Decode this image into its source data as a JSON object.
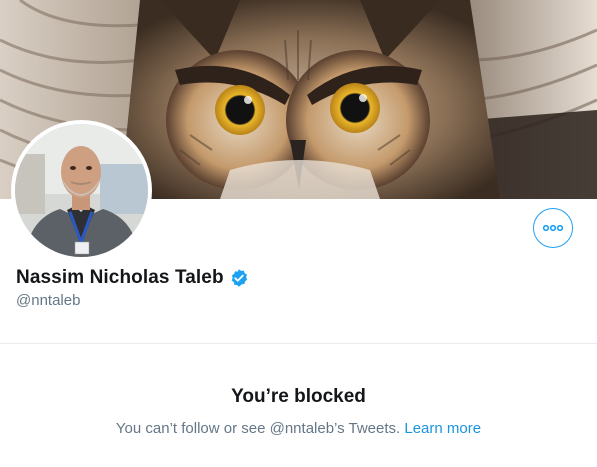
{
  "profile": {
    "display_name": "Nassim Nicholas Taleb",
    "handle": "@nntaleb"
  },
  "icons": {
    "verified": "verified-badge-icon",
    "more": "more-horizontal-icon"
  },
  "blocked": {
    "title": "You’re blocked",
    "message_prefix": "You can’t follow or see @nntaleb’s Tweets.",
    "learn_more": "Learn more"
  },
  "colors": {
    "accent": "#1da1f2",
    "link": "#1b95e0",
    "secondary_text": "#657786",
    "primary_text": "#14171a",
    "divider": "#e6ecf0"
  }
}
